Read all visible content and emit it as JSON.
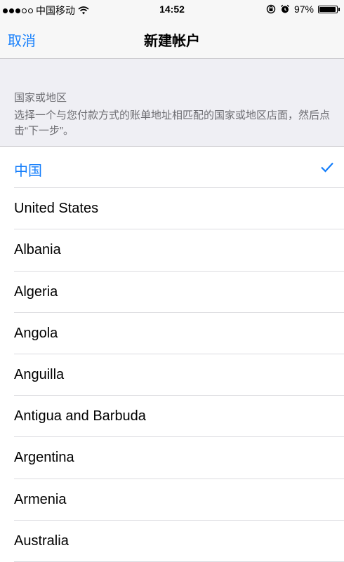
{
  "status_bar": {
    "carrier": "中国移动",
    "time": "14:52",
    "battery_percent": "97%",
    "battery_level": 0.97
  },
  "nav": {
    "cancel_label": "取消",
    "title": "新建帐户"
  },
  "section": {
    "title": "国家或地区",
    "description": "选择一个与您付款方式的账单地址相匹配的国家或地区店面，然后点击“下一步”。"
  },
  "countries": [
    {
      "label": "中国",
      "selected": true
    },
    {
      "label": "United States"
    },
    {
      "label": "Albania"
    },
    {
      "label": "Algeria"
    },
    {
      "label": "Angola"
    },
    {
      "label": "Anguilla"
    },
    {
      "label": "Antigua and Barbuda"
    },
    {
      "label": "Argentina"
    },
    {
      "label": "Armenia"
    },
    {
      "label": "Australia"
    }
  ],
  "colors": {
    "accent": "#147efb",
    "header_bg": "#efeff4",
    "secondary_text": "#6d6d72"
  }
}
